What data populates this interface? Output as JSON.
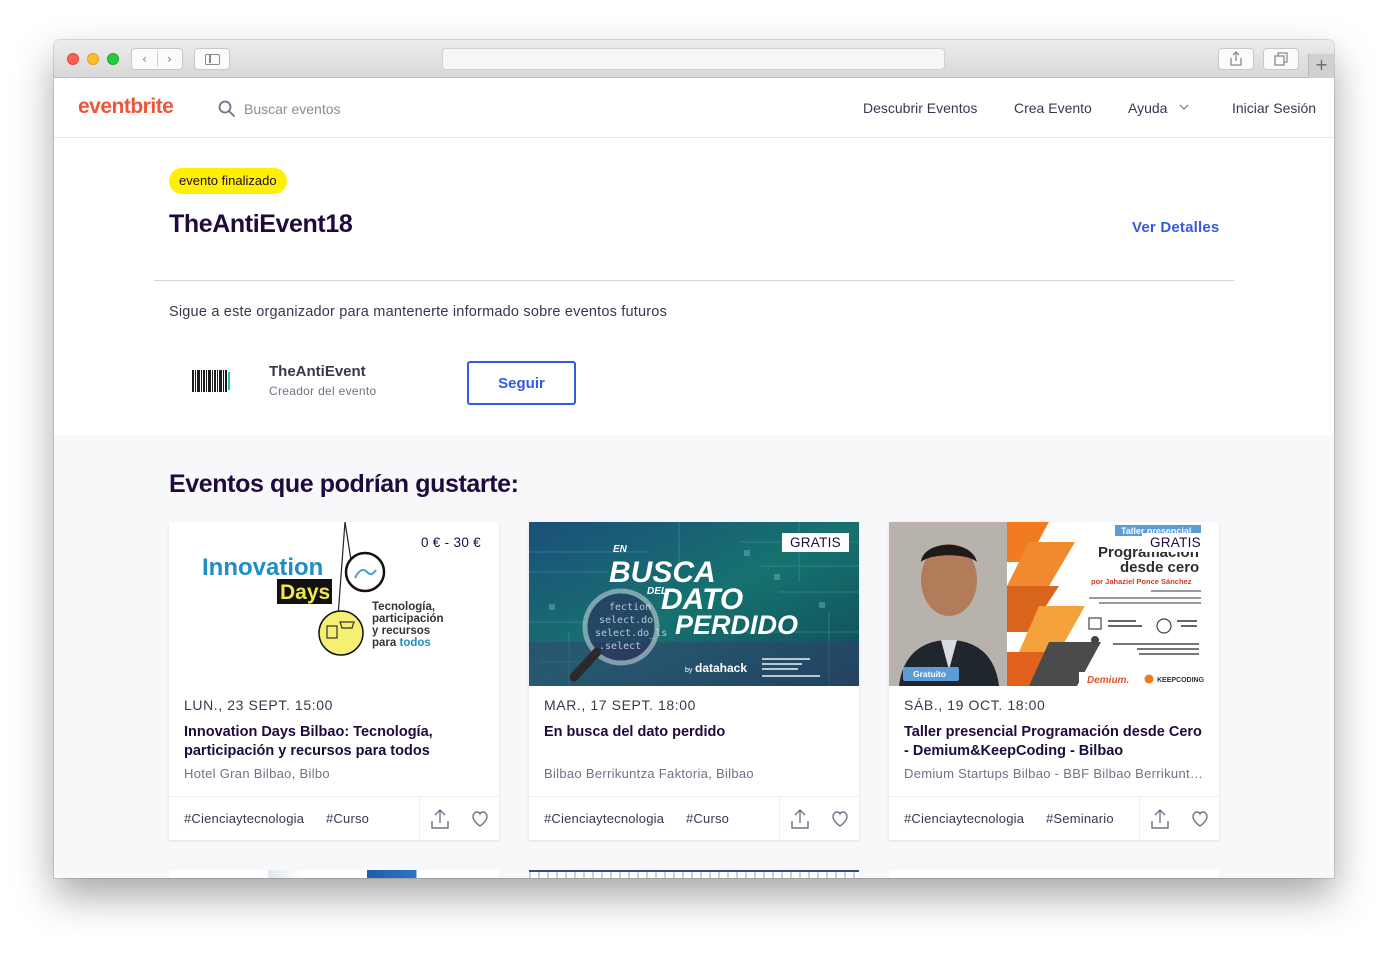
{
  "header": {
    "logo": "eventbrite",
    "search_placeholder": "Buscar eventos",
    "nav": {
      "discover": "Descubrir Eventos",
      "create": "Crea Evento",
      "help": "Ayuda",
      "login": "Iniciar Sesión"
    }
  },
  "event": {
    "status_badge": "evento finalizado",
    "title": "TheAntiEvent18",
    "details_link": "Ver Detalles"
  },
  "organizer": {
    "follow_prompt": "Sigue a este organizador para mantenerte informado sobre eventos futuros",
    "name": "TheAntiEvent",
    "role": "Creador del evento",
    "follow_button": "Seguir"
  },
  "suggestions": {
    "title": "Eventos que podrían gustarte:",
    "cards": [
      {
        "price": "0 € - 30 €",
        "date": "LUN., 23 SEPT. 15:00",
        "title": "Innovation Days Bilbao: Tecnología, participación y recursos para todos",
        "venue": "Hotel Gran Bilbao, Bilbo",
        "tags": [
          "#Cienciaytecnologia",
          "#Curso"
        ],
        "image": {
          "brand_top": "Innovation",
          "brand_bottom": "Days",
          "line1": "Tecnología,",
          "line2": "participación",
          "line3": "y recursos",
          "line4_a": "para ",
          "line4_b": "todos"
        }
      },
      {
        "price": "GRATIS",
        "date": "MAR., 17 SEPT. 18:00",
        "title": "En busca del dato perdido",
        "venue": "Bilbao Berrikuntza Faktoria, Bilbao",
        "tags": [
          "#Cienciaytecnologia",
          "#Curso"
        ],
        "image": {
          "en": "EN",
          "busca": "BUSCA",
          "del": "DEL",
          "dato": "DATO",
          "perdido": "PERDIDO",
          "by": "by",
          "brand": "datahack"
        }
      },
      {
        "price": "GRATIS",
        "date": "SÁB., 19 OCT. 18:00",
        "title": "Taller presencial Programación desde Cero - Demium&KeepCoding - Bilbao",
        "venue": "Demium Startups Bilbao - BBF Bilbao Berrikuntza Faktoria",
        "tags": [
          "#Cienciaytecnologia",
          "#Seminario"
        ],
        "image": {
          "ribbon": "Taller presencial",
          "headline1": "Programación",
          "headline2": "desde cero",
          "byline": "por Jahaziel Ponce Sánchez",
          "free_label": "Gratuito",
          "brand1": "Demium.",
          "brand2": "KEEPCODING"
        }
      }
    ]
  },
  "colors": {
    "brand": "#f05537",
    "link": "#3659e3",
    "badge": "#ffef00",
    "ink": "#1e0a3c"
  }
}
